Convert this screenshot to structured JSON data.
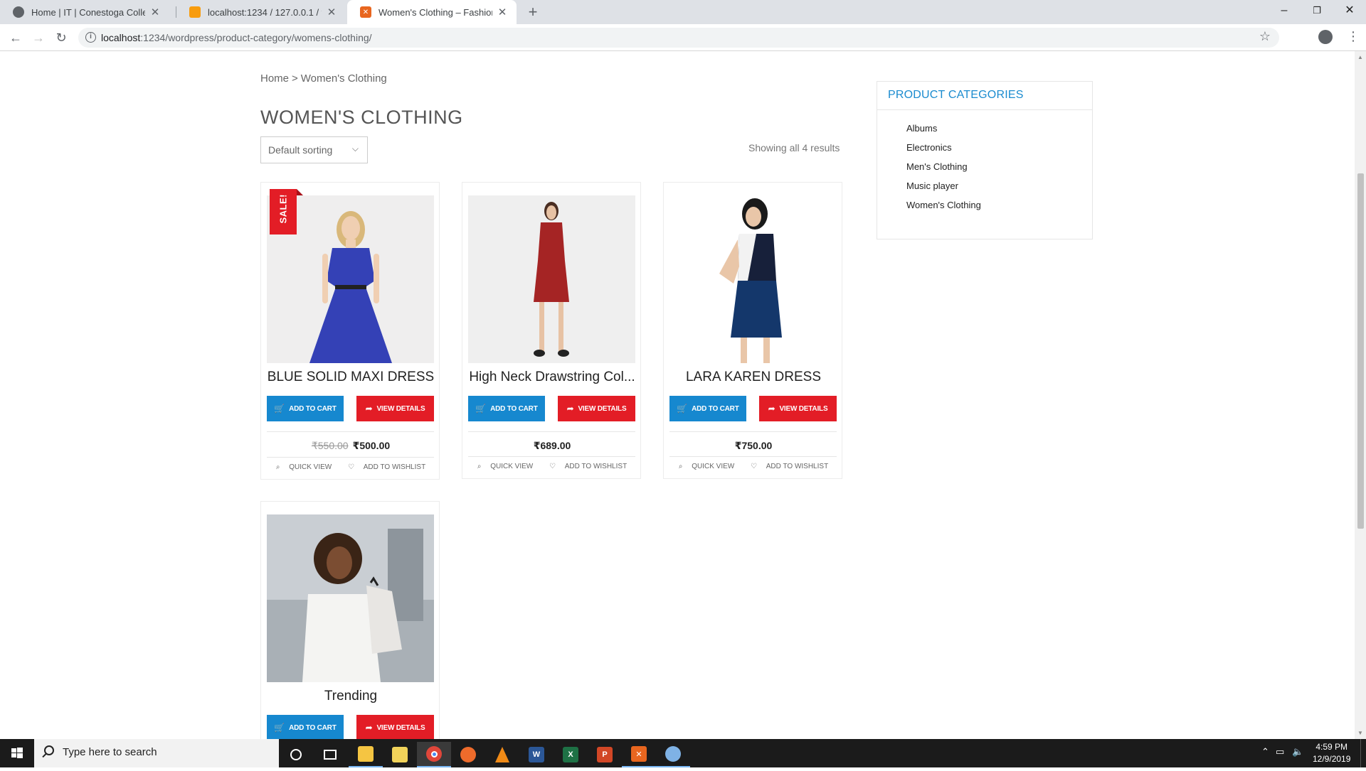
{
  "browser": {
    "tabs": [
      {
        "title": "Home | IT | Conestoga College",
        "favicon_color": "#5f6368"
      },
      {
        "title": "localhost:1234 / 127.0.0.1 / word",
        "favicon_color": "#f89c0e"
      },
      {
        "title": "Women's Clothing – Fashion Wo",
        "favicon_color": "#e8661f"
      }
    ],
    "url_host": "localhost",
    "url_rest": ":1234/wordpress/product-category/womens-clothing/"
  },
  "breadcrumb": {
    "home": "Home",
    "sep": ">",
    "current": "Women's Clothing"
  },
  "page_title": "WOMEN'S CLOTHING",
  "sorting": {
    "selected": "Default sorting"
  },
  "results_text": "Showing all 4 results",
  "products": [
    {
      "name": "BLUE SOLID MAXI DRESS",
      "sale_badge": "SALE!",
      "old_price": "₹550.00",
      "price": "₹500.00",
      "add_to_cart": "ADD TO CART",
      "view_details": "VIEW DETAILS",
      "quick_view": "QUICK VIEW",
      "wishlist": "ADD TO WISHLIST"
    },
    {
      "name": "High Neck Drawstring Col...",
      "price": "₹689.00",
      "add_to_cart": "ADD TO CART",
      "view_details": "VIEW DETAILS",
      "quick_view": "QUICK VIEW",
      "wishlist": "ADD TO WISHLIST"
    },
    {
      "name": "LARA KAREN DRESS",
      "price": "₹750.00",
      "add_to_cart": "ADD TO CART",
      "view_details": "VIEW DETAILS",
      "quick_view": "QUICK VIEW",
      "wishlist": "ADD TO WISHLIST"
    },
    {
      "name": "Trending",
      "add_to_cart": "ADD TO CART",
      "view_details": "VIEW DETAILS"
    }
  ],
  "sidebar": {
    "title": "PRODUCT CATEGORIES",
    "categories": [
      "Albums",
      "Electronics",
      "Men's Clothing",
      "Music player",
      "Women's Clothing"
    ]
  },
  "taskbar": {
    "search_placeholder": "Type here to search",
    "time": "4:59 PM",
    "date": "12/9/2019"
  },
  "colors": {
    "cart_blue": "#1688cf",
    "view_red": "#e31d26",
    "widget_title": "#1a8bcf"
  }
}
